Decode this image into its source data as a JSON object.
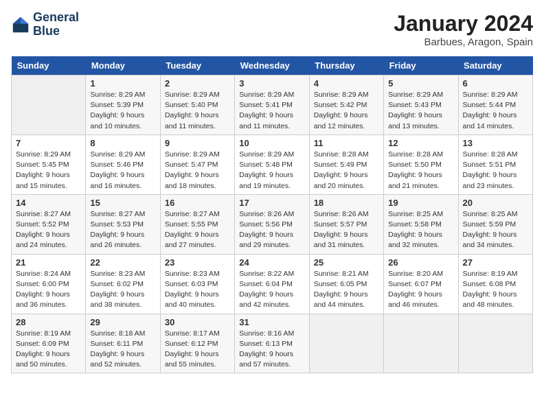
{
  "header": {
    "logo_line1": "General",
    "logo_line2": "Blue",
    "month": "January 2024",
    "location": "Barbues, Aragon, Spain"
  },
  "weekdays": [
    "Sunday",
    "Monday",
    "Tuesday",
    "Wednesday",
    "Thursday",
    "Friday",
    "Saturday"
  ],
  "weeks": [
    [
      {
        "day": "",
        "empty": true
      },
      {
        "day": "1",
        "sunrise": "8:29 AM",
        "sunset": "5:39 PM",
        "daylight": "9 hours and 10 minutes."
      },
      {
        "day": "2",
        "sunrise": "8:29 AM",
        "sunset": "5:40 PM",
        "daylight": "9 hours and 11 minutes."
      },
      {
        "day": "3",
        "sunrise": "8:29 AM",
        "sunset": "5:41 PM",
        "daylight": "9 hours and 11 minutes."
      },
      {
        "day": "4",
        "sunrise": "8:29 AM",
        "sunset": "5:42 PM",
        "daylight": "9 hours and 12 minutes."
      },
      {
        "day": "5",
        "sunrise": "8:29 AM",
        "sunset": "5:43 PM",
        "daylight": "9 hours and 13 minutes."
      },
      {
        "day": "6",
        "sunrise": "8:29 AM",
        "sunset": "5:44 PM",
        "daylight": "9 hours and 14 minutes."
      }
    ],
    [
      {
        "day": "7",
        "sunrise": "8:29 AM",
        "sunset": "5:45 PM",
        "daylight": "9 hours and 15 minutes."
      },
      {
        "day": "8",
        "sunrise": "8:29 AM",
        "sunset": "5:46 PM",
        "daylight": "9 hours and 16 minutes."
      },
      {
        "day": "9",
        "sunrise": "8:29 AM",
        "sunset": "5:47 PM",
        "daylight": "9 hours and 18 minutes."
      },
      {
        "day": "10",
        "sunrise": "8:29 AM",
        "sunset": "5:48 PM",
        "daylight": "9 hours and 19 minutes."
      },
      {
        "day": "11",
        "sunrise": "8:28 AM",
        "sunset": "5:49 PM",
        "daylight": "9 hours and 20 minutes."
      },
      {
        "day": "12",
        "sunrise": "8:28 AM",
        "sunset": "5:50 PM",
        "daylight": "9 hours and 21 minutes."
      },
      {
        "day": "13",
        "sunrise": "8:28 AM",
        "sunset": "5:51 PM",
        "daylight": "9 hours and 23 minutes."
      }
    ],
    [
      {
        "day": "14",
        "sunrise": "8:27 AM",
        "sunset": "5:52 PM",
        "daylight": "9 hours and 24 minutes."
      },
      {
        "day": "15",
        "sunrise": "8:27 AM",
        "sunset": "5:53 PM",
        "daylight": "9 hours and 26 minutes."
      },
      {
        "day": "16",
        "sunrise": "8:27 AM",
        "sunset": "5:55 PM",
        "daylight": "9 hours and 27 minutes."
      },
      {
        "day": "17",
        "sunrise": "8:26 AM",
        "sunset": "5:56 PM",
        "daylight": "9 hours and 29 minutes."
      },
      {
        "day": "18",
        "sunrise": "8:26 AM",
        "sunset": "5:57 PM",
        "daylight": "9 hours and 31 minutes."
      },
      {
        "day": "19",
        "sunrise": "8:25 AM",
        "sunset": "5:58 PM",
        "daylight": "9 hours and 32 minutes."
      },
      {
        "day": "20",
        "sunrise": "8:25 AM",
        "sunset": "5:59 PM",
        "daylight": "9 hours and 34 minutes."
      }
    ],
    [
      {
        "day": "21",
        "sunrise": "8:24 AM",
        "sunset": "6:00 PM",
        "daylight": "9 hours and 36 minutes."
      },
      {
        "day": "22",
        "sunrise": "8:23 AM",
        "sunset": "6:02 PM",
        "daylight": "9 hours and 38 minutes."
      },
      {
        "day": "23",
        "sunrise": "8:23 AM",
        "sunset": "6:03 PM",
        "daylight": "9 hours and 40 minutes."
      },
      {
        "day": "24",
        "sunrise": "8:22 AM",
        "sunset": "6:04 PM",
        "daylight": "9 hours and 42 minutes."
      },
      {
        "day": "25",
        "sunrise": "8:21 AM",
        "sunset": "6:05 PM",
        "daylight": "9 hours and 44 minutes."
      },
      {
        "day": "26",
        "sunrise": "8:20 AM",
        "sunset": "6:07 PM",
        "daylight": "9 hours and 46 minutes."
      },
      {
        "day": "27",
        "sunrise": "8:19 AM",
        "sunset": "6:08 PM",
        "daylight": "9 hours and 48 minutes."
      }
    ],
    [
      {
        "day": "28",
        "sunrise": "8:19 AM",
        "sunset": "6:09 PM",
        "daylight": "9 hours and 50 minutes."
      },
      {
        "day": "29",
        "sunrise": "8:18 AM",
        "sunset": "6:11 PM",
        "daylight": "9 hours and 52 minutes."
      },
      {
        "day": "30",
        "sunrise": "8:17 AM",
        "sunset": "6:12 PM",
        "daylight": "9 hours and 55 minutes."
      },
      {
        "day": "31",
        "sunrise": "8:16 AM",
        "sunset": "6:13 PM",
        "daylight": "9 hours and 57 minutes."
      },
      {
        "day": "",
        "empty": true
      },
      {
        "day": "",
        "empty": true
      },
      {
        "day": "",
        "empty": true
      }
    ]
  ]
}
